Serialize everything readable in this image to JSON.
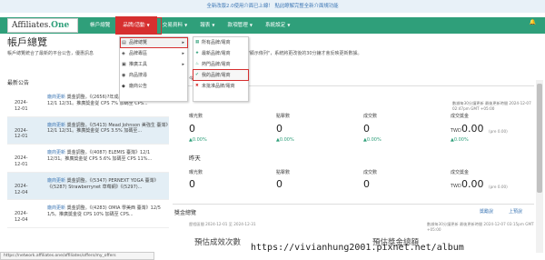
{
  "notice": "全新改版2.0使用介面已上線！ 點此瞭解完整全新介面規功能",
  "logo": {
    "part1": "Affiliates.",
    "part2": "One"
  },
  "nav": [
    {
      "label": "帳戶總覽"
    },
    {
      "label": "品牌/活動"
    },
    {
      "label": "交易資料"
    },
    {
      "label": "報表"
    },
    {
      "label": "款項管理"
    },
    {
      "label": "系統設定"
    }
  ],
  "page": {
    "title": "帳戶總覽",
    "desc_left": "帳戶總覽統合了最新的平台公告，優惠訊息",
    "desc_right": "的 \"顯示條列\"，系統將更改後的30分鐘才會反映更新數據。"
  },
  "announcements": {
    "heading": "最新公告",
    "more": "更多",
    "items": [
      {
        "date": "2024-12-01",
        "tag": "廠商更新",
        "text": "獎金調整。《(2656)?年成品牌 台灣動力(網)》12/1 12/31。推廣獎金從 CPS 7% 加碼至 CPS..."
      },
      {
        "date": "2024-12-01",
        "tag": "廠商更新",
        "text": "獎金調整。《(5413) Mead Johnson 美強生 臺灣》12/1 12/31。推廣獎金從 CPS 3.5% 加碼至..."
      },
      {
        "date": "2024-12-01",
        "tag": "廠商更新",
        "text": "獎金調整。《(4087) ELEMIS 臺灣》12/1 12/31。推廣獎金從 CPS 5.6% 加碼至 CPS 11%..."
      },
      {
        "date": "2024-12-04",
        "tag": "廠商更新",
        "text": "獎金調整。《(5347) PERNEXT YOGA 臺灣》《(5287) Strawberrynet 草莓網》《(5297)..."
      },
      {
        "date": "2024-12-04",
        "tag": "廠商更新",
        "text": "獎金調整。《(4283) OMIA 學美西 臺灣》12/5 1/5。推廣獎金從 CPS 10% 加碼至 CPS..."
      }
    ]
  },
  "summary": {
    "tab_today": "今日",
    "tab_month": "本月",
    "updated": "數據每30分鐘更新 最後更新時間 2024-12-07 02:47pm GMT +05:00",
    "today_metrics": [
      {
        "label": "曝光數",
        "value": "0",
        "pct": "▲0.00%"
      },
      {
        "label": "點擊數",
        "value": "0",
        "pct": "▲0.00%"
      },
      {
        "label": "成交數",
        "value": "0",
        "pct": "▲0.00%"
      },
      {
        "label": "成交獎金",
        "value": "0.00",
        "prefix": "TWD",
        "sub": "(pre 0.00)",
        "pct": "▲0.00%"
      }
    ],
    "yesterday": "昨天",
    "yesterday_metrics": [
      {
        "label": "曝光數",
        "value": "0"
      },
      {
        "label": "點擊數",
        "value": "0"
      },
      {
        "label": "成交數",
        "value": "0"
      },
      {
        "label": "成交獎金",
        "value": "0.00",
        "prefix": "TWD",
        "sub": "(pre 0.00)"
      }
    ]
  },
  "commission": {
    "heading": "獎金總覽",
    "link1": "獎勵說",
    "link2": "上預說",
    "period": "歷程區間 2024-12-01 至 2024-12-31",
    "updated": "數據每30分鐘更新 最後更新時間 2024-12-07 03:15pm GMT +05:00",
    "col1": "預估成效次數",
    "col2": "預估獎金總額"
  },
  "menu": {
    "level1": [
      {
        "label": "品牌總覽",
        "icon": "list-icon",
        "has_sub": true
      },
      {
        "label": "品牌專區",
        "icon": "tag-icon",
        "has_sub": true
      },
      {
        "label": "推廣工具",
        "icon": "tool-icon",
        "has_sub": true
      },
      {
        "label": "商品搜尋",
        "icon": "search-icon",
        "has_sub": false
      },
      {
        "label": "廠商公告",
        "icon": "bell-icon",
        "has_sub": false
      }
    ],
    "level2": [
      {
        "label": "所有品牌/電商",
        "icon": "grid-icon"
      },
      {
        "label": "最新品牌/電商",
        "icon": "star-icon"
      },
      {
        "label": "熱門品牌/電商",
        "icon": "fire-icon"
      },
      {
        "label": "我的品牌/電商",
        "icon": "check-icon"
      },
      {
        "label": "未批准品牌/電商",
        "icon": "x-icon"
      }
    ]
  },
  "status_url": "https://network.affiliates.one/affiliates/offers/my_offers",
  "watermark": "https://vivianhung2001.pixnet.net/album",
  "colors": {
    "brand": "#2f9f7a",
    "highlight": "#d62f2f",
    "link": "#3f78b5"
  }
}
